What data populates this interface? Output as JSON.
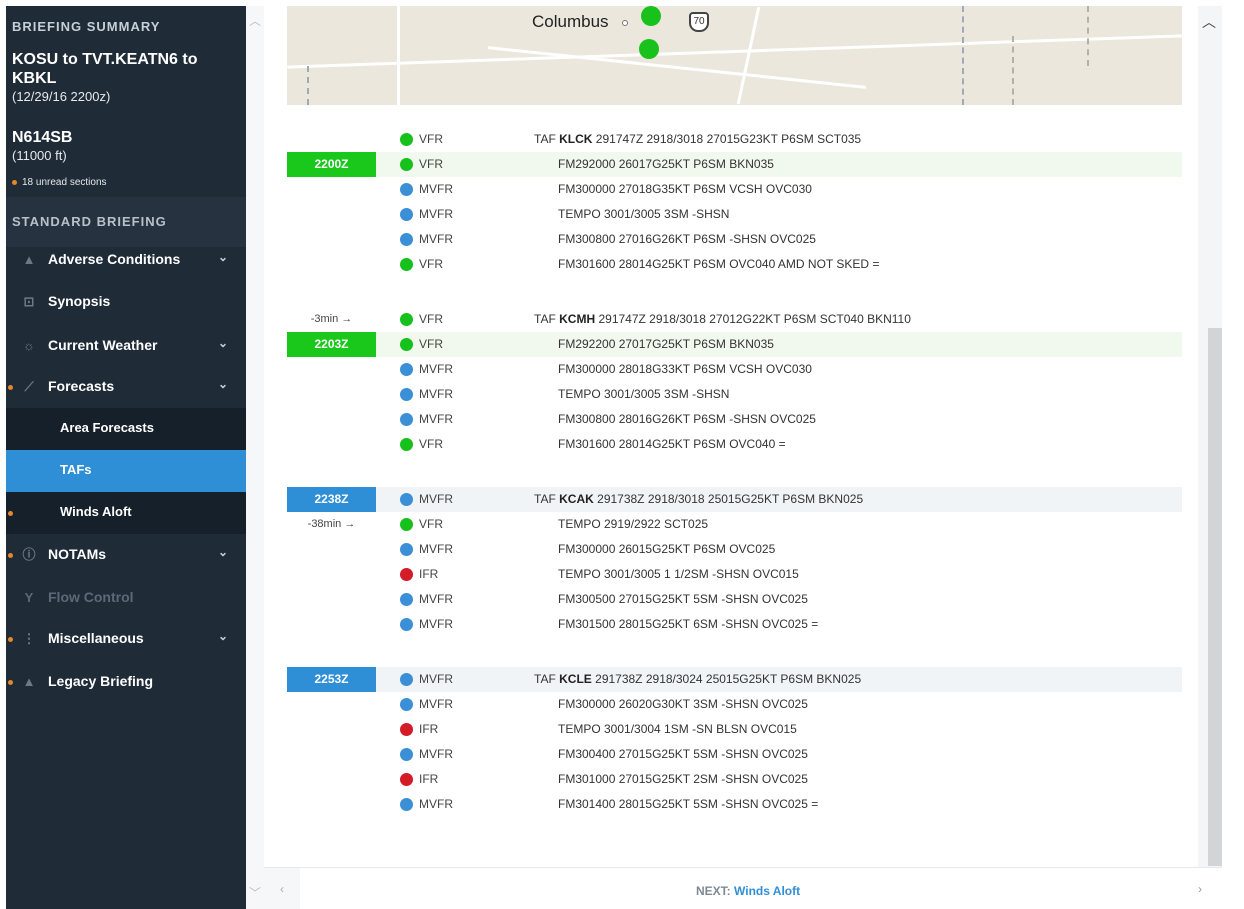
{
  "sidebar": {
    "summary_title": "BRIEFING SUMMARY",
    "route": "KOSU to TVT.KEATN6 to KBKL",
    "route_date": "(12/29/16 2200z)",
    "tail": "N614SB",
    "altitude": "(11000 ft)",
    "unread": "18 unread sections",
    "section_title": "STANDARD BRIEFING",
    "items": [
      {
        "label": "Adverse Conditions",
        "icon": "warning-icon",
        "glyph": "▲"
      },
      {
        "label": "Synopsis",
        "icon": "chart-icon",
        "glyph": "⊡"
      },
      {
        "label": "Current Weather",
        "icon": "weather-icon",
        "glyph": "☼"
      },
      {
        "label": "Forecasts",
        "icon": "trend-icon",
        "glyph": "⟋"
      },
      {
        "label": "Area Forecasts"
      },
      {
        "label": "TAFs"
      },
      {
        "label": "Winds Aloft"
      },
      {
        "label": "NOTAMs",
        "icon": "info-icon",
        "glyph": "ⓘ"
      },
      {
        "label": "Flow Control",
        "icon": "flow-icon",
        "glyph": "Y"
      },
      {
        "label": "Miscellaneous",
        "icon": "more-icon",
        "glyph": "⋮"
      },
      {
        "label": "Legacy Briefing",
        "icon": "warning-icon",
        "glyph": "▲"
      }
    ]
  },
  "map": {
    "city": "Columbus",
    "highway": "70"
  },
  "colors": {
    "vfr": "#16c11c",
    "mvfr": "#3a8fd6",
    "ifr": "#d31c27",
    "sidebar": "#1f2b37",
    "active": "#2f8fd6"
  },
  "tafs": [
    {
      "station": "KLCK",
      "header": "291747Z 2918/3018 27015G23KT P6SM SCT035",
      "tag": "2200Z",
      "lines": [
        {
          "cat": "VFR",
          "text": "FM292000 26017G25KT P6SM BKN035"
        },
        {
          "cat": "MVFR",
          "text": "FM300000 27018G35KT P6SM VCSH OVC030"
        },
        {
          "cat": "MVFR",
          "text": "TEMPO 3001/3005 3SM -SHSN"
        },
        {
          "cat": "MVFR",
          "text": "FM300800 27016G26KT P6SM -SHSN OVC025"
        },
        {
          "cat": "VFR",
          "text": "FM301600 28014G25KT P6SM OVC040 AMD NOT SKED ="
        }
      ],
      "header_cat": "VFR"
    },
    {
      "station": "KCMH",
      "header": "291747Z 2918/3018 27012G22KT P6SM SCT040 BKN110",
      "eta": "-3min →",
      "tag": "2203Z",
      "lines": [
        {
          "cat": "VFR",
          "text": "FM292200 27017G25KT P6SM BKN035"
        },
        {
          "cat": "MVFR",
          "text": "FM300000 28018G33KT P6SM VCSH OVC030"
        },
        {
          "cat": "MVFR",
          "text": "TEMPO 3001/3005 3SM -SHSN"
        },
        {
          "cat": "MVFR",
          "text": "FM300800 28016G26KT P6SM -SHSN OVC025"
        },
        {
          "cat": "VFR",
          "text": "FM301600 28014G25KT P6SM OVC040 ="
        }
      ],
      "header_cat": "VFR"
    },
    {
      "station": "KCAK",
      "header": "291738Z 2918/3018 25015G25KT P6SM BKN025",
      "tag": "2238Z",
      "eta": "-38min →",
      "lines": [
        {
          "cat": "VFR",
          "text": "TEMPO 2919/2922 SCT025"
        },
        {
          "cat": "MVFR",
          "text": "FM300000 26015G25KT P6SM OVC025"
        },
        {
          "cat": "IFR",
          "text": "TEMPO 3001/3005 1 1/2SM -SHSN OVC015"
        },
        {
          "cat": "MVFR",
          "text": "FM300500 27015G25KT 5SM -SHSN OVC025"
        },
        {
          "cat": "MVFR",
          "text": "FM301500 28015G25KT 6SM -SHSN OVC025 ="
        }
      ],
      "header_cat": "MVFR"
    },
    {
      "station": "KCLE",
      "header": "291738Z 2918/3024 25015G25KT P6SM BKN025",
      "tag": "2253Z",
      "lines": [
        {
          "cat": "MVFR",
          "text": "FM300000 26020G30KT 3SM -SHSN OVC025"
        },
        {
          "cat": "IFR",
          "text": "TEMPO 3001/3004 1SM -SN BLSN OVC015"
        },
        {
          "cat": "MVFR",
          "text": "FM300400 27015G25KT 5SM -SHSN OVC025"
        },
        {
          "cat": "IFR",
          "text": "FM301000 27015G25KT 2SM -SHSN OVC025"
        },
        {
          "cat": "MVFR",
          "text": "FM301400 28015G25KT 5SM -SHSN OVC025 ="
        }
      ],
      "header_cat": "MVFR"
    }
  ],
  "taf_prefix": "TAF",
  "footer": {
    "next_prefix": "NEXT:",
    "next_label": "Winds Aloft"
  }
}
